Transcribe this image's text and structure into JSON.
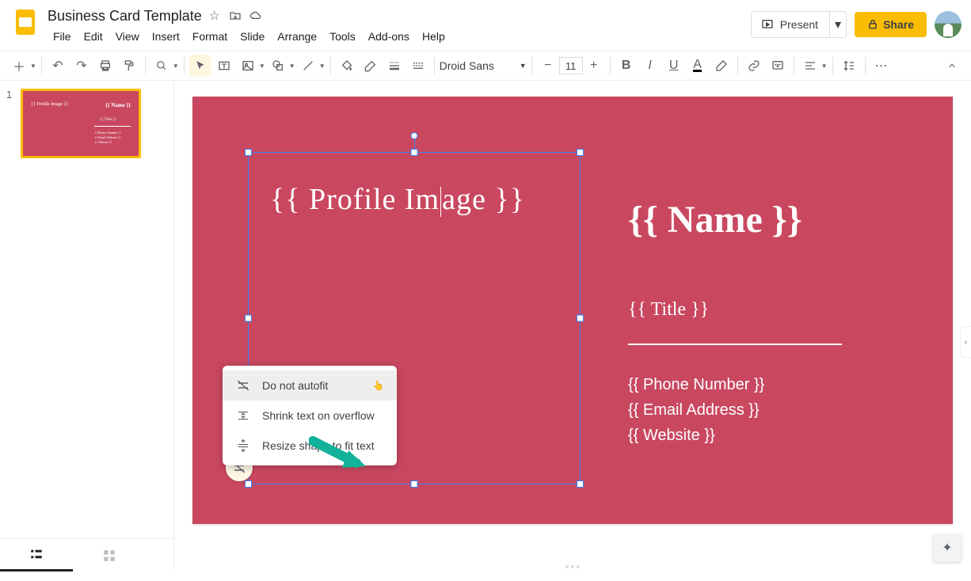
{
  "doc": {
    "title": "Business Card Template"
  },
  "menu": {
    "file": "File",
    "edit": "Edit",
    "view": "View",
    "insert": "Insert",
    "format": "Format",
    "slide": "Slide",
    "arrange": "Arrange",
    "tools": "Tools",
    "addons": "Add-ons",
    "help": "Help"
  },
  "buttons": {
    "present": "Present",
    "share": "Share"
  },
  "toolbar": {
    "font": "Droid Sans",
    "fontSize": "11"
  },
  "thumb": {
    "number": "1"
  },
  "slide": {
    "profileImage": "{{ Profile Image }}",
    "name": "{{ Name }}",
    "title": "{{ Title }}",
    "phone": "{{ Phone Number }}",
    "email": "{{ Email Address }}",
    "website": "{{ Website }}"
  },
  "autofit": {
    "doNot": "Do not autofit",
    "shrink": "Shrink text on overflow",
    "resize": "Resize shape to fit text"
  }
}
